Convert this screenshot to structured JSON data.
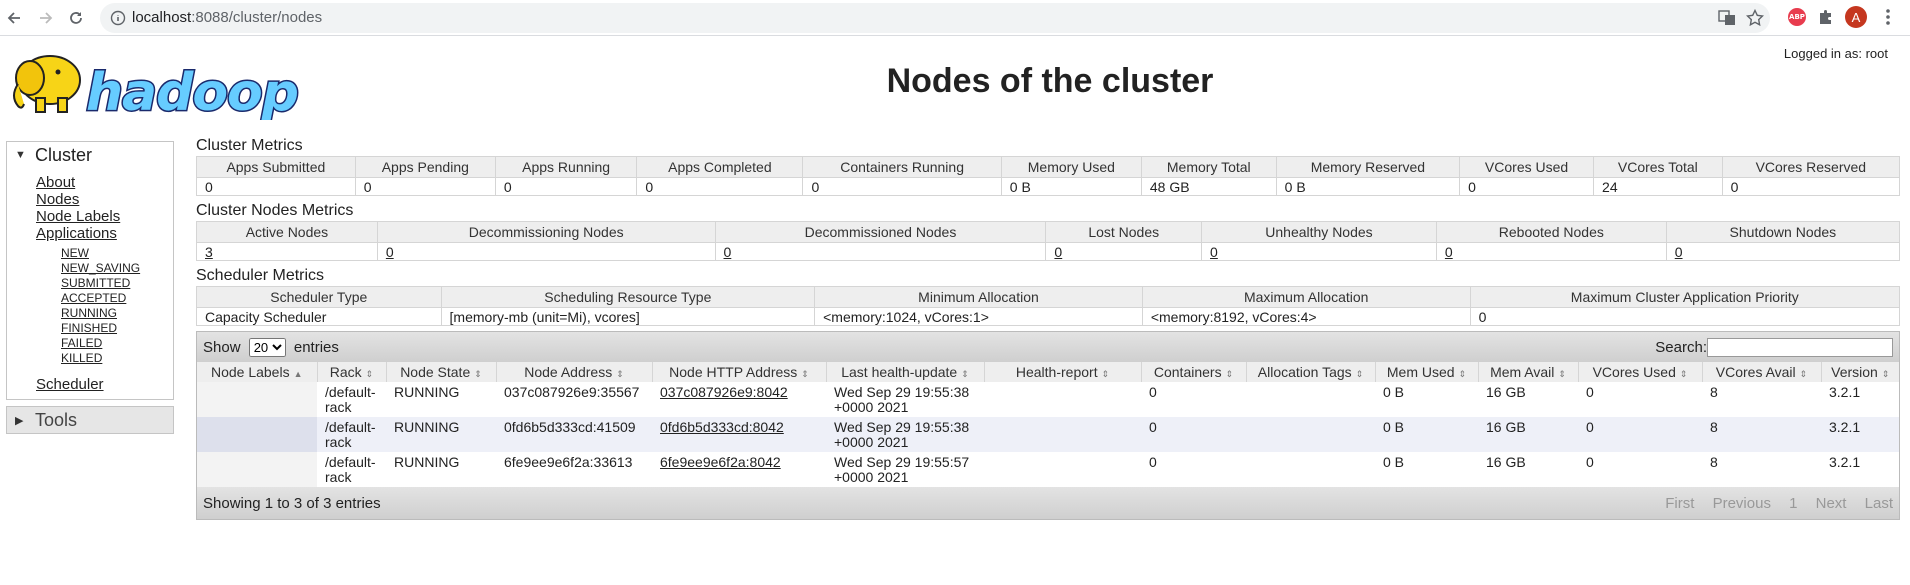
{
  "browser": {
    "url_host": "localhost",
    "url_rest": ":8088/cluster/nodes",
    "profile_initial": "A",
    "abp_label": "ABP"
  },
  "header": {
    "logo_text": "hadoop",
    "title": "Nodes of the cluster",
    "logged_in": "Logged in as: root"
  },
  "sidebar": {
    "cluster_label": "Cluster",
    "cluster_links": [
      "About",
      "Nodes",
      "Node Labels",
      "Applications"
    ],
    "app_states": [
      "NEW",
      "NEW_SAVING",
      "SUBMITTED",
      "ACCEPTED",
      "RUNNING",
      "FINISHED",
      "FAILED",
      "KILLED"
    ],
    "scheduler_label": "Scheduler",
    "tools_label": "Tools"
  },
  "cluster_metrics": {
    "title": "Cluster Metrics",
    "headers": [
      "Apps Submitted",
      "Apps Pending",
      "Apps Running",
      "Apps Completed",
      "Containers Running",
      "Memory Used",
      "Memory Total",
      "Memory Reserved",
      "VCores Used",
      "VCores Total",
      "VCores Reserved"
    ],
    "values": [
      "0",
      "0",
      "0",
      "0",
      "0",
      "0 B",
      "48 GB",
      "0 B",
      "0",
      "24",
      "0"
    ]
  },
  "node_metrics": {
    "title": "Cluster Nodes Metrics",
    "headers": [
      "Active Nodes",
      "Decommissioning Nodes",
      "Decommissioned Nodes",
      "Lost Nodes",
      "Unhealthy Nodes",
      "Rebooted Nodes",
      "Shutdown Nodes"
    ],
    "values": [
      "3",
      "0",
      "0",
      "0",
      "0",
      "0",
      "0"
    ]
  },
  "scheduler_metrics": {
    "title": "Scheduler Metrics",
    "headers": [
      "Scheduler Type",
      "Scheduling Resource Type",
      "Minimum Allocation",
      "Maximum Allocation",
      "Maximum Cluster Application Priority"
    ],
    "values": [
      "Capacity Scheduler",
      "[memory-mb (unit=Mi), vcores]",
      "<memory:1024, vCores:1>",
      "<memory:8192, vCores:4>",
      "0"
    ]
  },
  "nodes_table": {
    "show_label": "Show",
    "entries_label": "entries",
    "page_size": "20",
    "search_label": "Search:",
    "columns": [
      "Node Labels",
      "Rack",
      "Node State",
      "Node Address",
      "Node HTTP Address",
      "Last health-update",
      "Health-report",
      "Containers",
      "Allocation Tags",
      "Mem Used",
      "Mem Avail",
      "VCores Used",
      "VCores Avail",
      "Version"
    ],
    "rows": [
      {
        "label": "",
        "rack": "/default-rack",
        "state": "RUNNING",
        "address": "037c087926e9:35567",
        "http": "037c087926e9:8042",
        "health_update": "Wed Sep 29 19:55:38 +0000 2021",
        "health_report": "",
        "containers": "0",
        "tags": "",
        "mem_used": "0 B",
        "mem_avail": "16 GB",
        "vcores_used": "0",
        "vcores_avail": "8",
        "version": "3.2.1"
      },
      {
        "label": "",
        "rack": "/default-rack",
        "state": "RUNNING",
        "address": "0fd6b5d333cd:41509",
        "http": "0fd6b5d333cd:8042",
        "health_update": "Wed Sep 29 19:55:38 +0000 2021",
        "health_report": "",
        "containers": "0",
        "tags": "",
        "mem_used": "0 B",
        "mem_avail": "16 GB",
        "vcores_used": "0",
        "vcores_avail": "8",
        "version": "3.2.1"
      },
      {
        "label": "",
        "rack": "/default-rack",
        "state": "RUNNING",
        "address": "6fe9ee9e6f2a:33613",
        "http": "6fe9ee9e6f2a:8042",
        "health_update": "Wed Sep 29 19:55:57 +0000 2021",
        "health_report": "",
        "containers": "0",
        "tags": "",
        "mem_used": "0 B",
        "mem_avail": "16 GB",
        "vcores_used": "0",
        "vcores_avail": "8",
        "version": "3.2.1"
      }
    ],
    "info": "Showing 1 to 3 of 3 entries",
    "pager": [
      "First",
      "Previous",
      "1",
      "Next",
      "Last"
    ]
  }
}
